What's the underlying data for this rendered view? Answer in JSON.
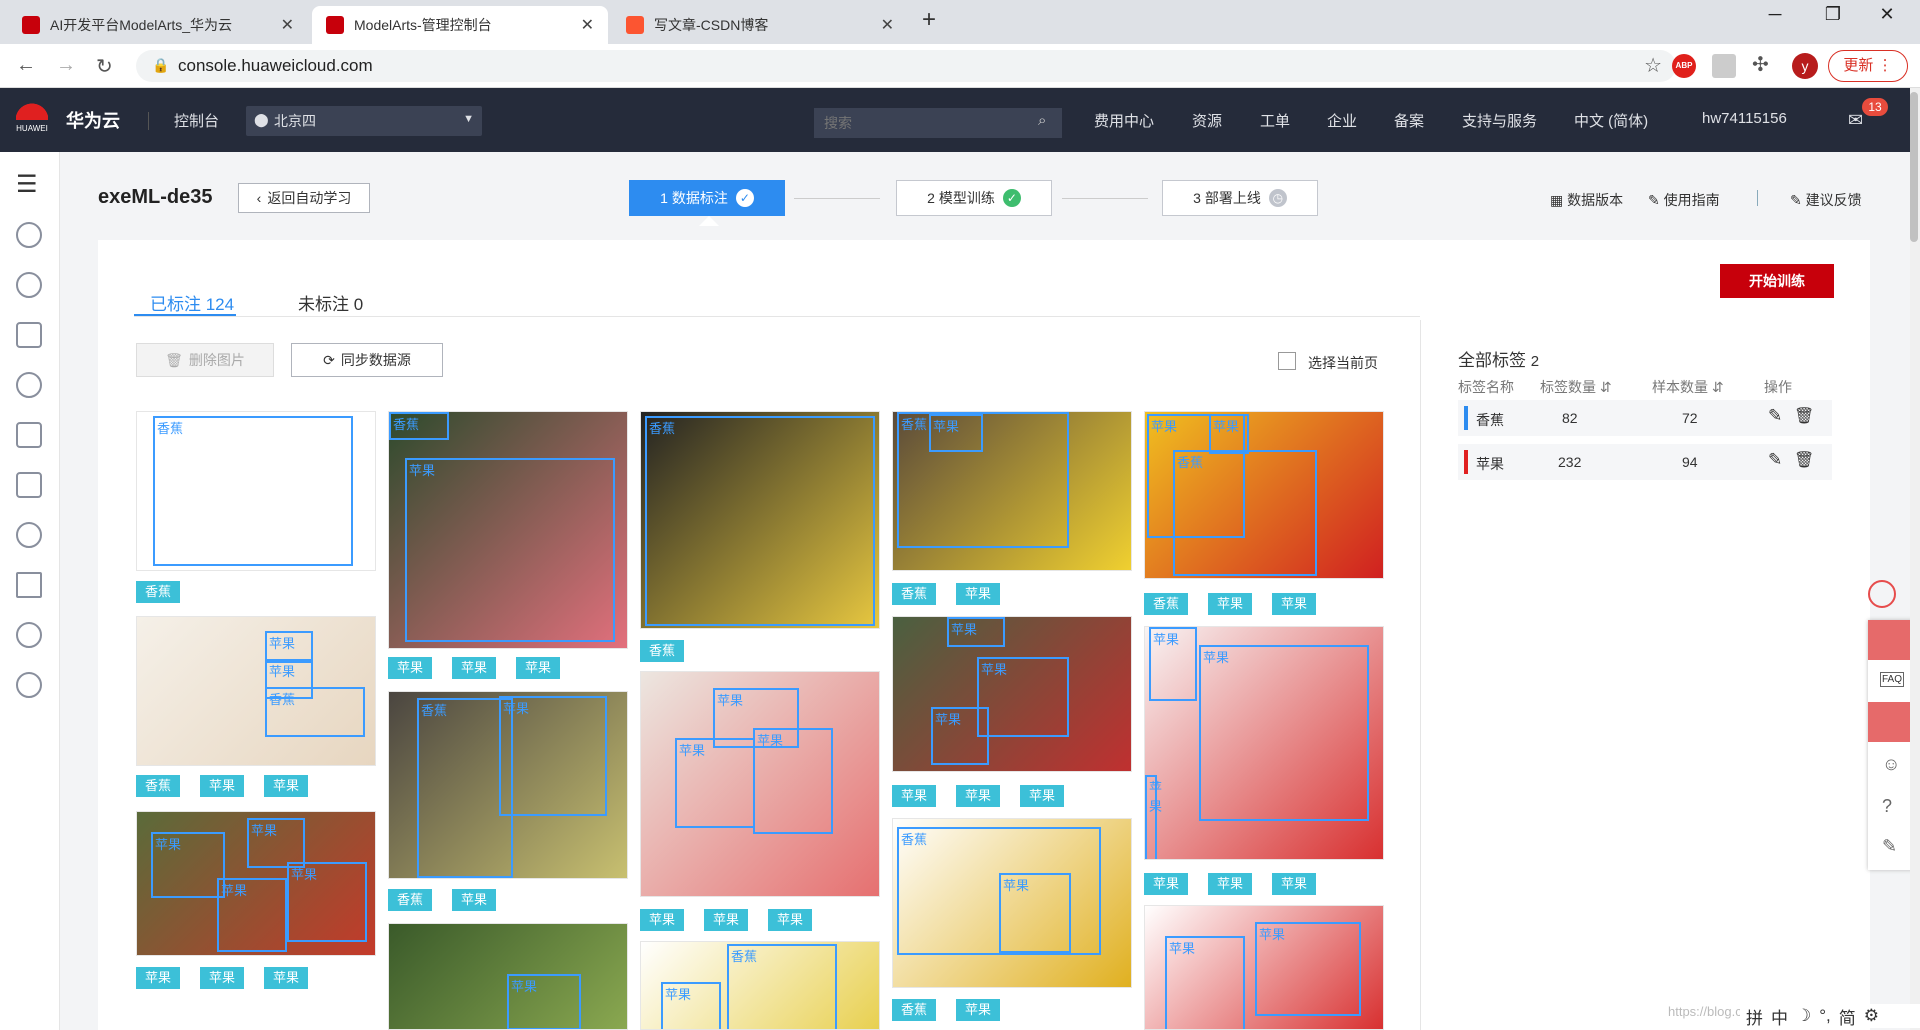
{
  "browser": {
    "tabs": [
      {
        "title": "AI开发平台ModelArts_华为云",
        "active": false
      },
      {
        "title": "ModelArts-管理控制台",
        "active": true
      },
      {
        "title": "写文章-CSDN博客",
        "active": false
      }
    ],
    "url": "console.huaweicloud.com",
    "update_label": "更新",
    "avatar_letter": "y",
    "abp_label": "ABP"
  },
  "header": {
    "brand": "华为云",
    "logo_text": "HUAWEI",
    "console_label": "控制台",
    "region": "北京四",
    "search_placeholder": "搜索",
    "nav": [
      "费用中心",
      "资源",
      "工单",
      "企业",
      "备案",
      "支持与服务",
      "中文 (简体)",
      "hw74115156"
    ],
    "mail_badge": "13"
  },
  "project": {
    "name": "exeML-de35",
    "back_label": "返回自动学习"
  },
  "steps": [
    {
      "label": "1 数据标注",
      "status": "done",
      "active": true
    },
    {
      "label": "2 模型训练",
      "status": "done",
      "active": false
    },
    {
      "label": "3 部署上线",
      "status": "pending",
      "active": false
    }
  ],
  "top_links": [
    "数据版本",
    "使用指南",
    "建议反馈"
  ],
  "start_button": "开始训练",
  "tabs": {
    "labeled": "已标注 124",
    "unlabeled": "未标注 0"
  },
  "actions": {
    "delete": "删除图片",
    "sync": "同步数据源",
    "select_page": "选择当前页"
  },
  "labels_panel": {
    "title": "全部标签",
    "count": "2",
    "columns": [
      "标签名称",
      "标签数量",
      "样本数量",
      "操作"
    ],
    "rows": [
      {
        "name": "香蕉",
        "label_count": "82",
        "sample_count": "72",
        "color": "#2d8cf0"
      },
      {
        "name": "苹果",
        "label_count": "232",
        "sample_count": "94",
        "color": "#e02020"
      }
    ]
  },
  "watermark": "https://blog.csdn.net",
  "ime": [
    "拼",
    "中",
    "简"
  ],
  "images": [
    {
      "tags": [
        "香蕉"
      ],
      "boxes": [
        "香蕉"
      ]
    },
    {
      "tags": [
        "香蕉",
        "苹果",
        "苹果"
      ],
      "boxes": [
        "苹果",
        "苹果",
        "香蕉"
      ]
    },
    {
      "tags": [
        "苹果",
        "苹果",
        "苹果"
      ],
      "boxes": [
        "苹果",
        "苹果",
        "苹果",
        "苹果"
      ]
    },
    {
      "tags": [
        "苹果",
        "苹果",
        "苹果"
      ],
      "boxes": [
        "香蕉",
        "苹果"
      ]
    },
    {
      "tags": [
        "香蕉",
        "苹果"
      ],
      "boxes": [
        "香蕉",
        "苹果"
      ]
    },
    {
      "tags": [],
      "boxes": [
        "苹果"
      ]
    },
    {
      "tags": [
        "香蕉"
      ],
      "boxes": [
        "香蕉"
      ]
    },
    {
      "tags": [
        "苹果",
        "苹果",
        "苹果"
      ],
      "boxes": [
        "苹果",
        "苹果",
        "苹果"
      ]
    },
    {
      "tags": [],
      "boxes": [
        "香蕉",
        "苹果"
      ]
    },
    {
      "tags": [
        "香蕉",
        "苹果"
      ],
      "boxes": [
        "香蕉",
        "苹果"
      ]
    },
    {
      "tags": [
        "苹果",
        "苹果",
        "苹果"
      ],
      "boxes": [
        "苹果",
        "苹果",
        "苹果"
      ]
    },
    {
      "tags": [
        "香蕉",
        "苹果"
      ],
      "boxes": [
        "香蕉",
        "苹果"
      ]
    },
    {
      "tags": [
        "香蕉",
        "苹果",
        "苹果"
      ],
      "boxes": [
        "苹果",
        "香蕉",
        "苹果"
      ]
    },
    {
      "tags": [
        "苹果",
        "苹果",
        "苹果"
      ],
      "boxes": [
        "苹果",
        "苹果",
        "苹果"
      ]
    },
    {
      "tags": [],
      "boxes": [
        "苹果",
        "苹果"
      ]
    }
  ]
}
